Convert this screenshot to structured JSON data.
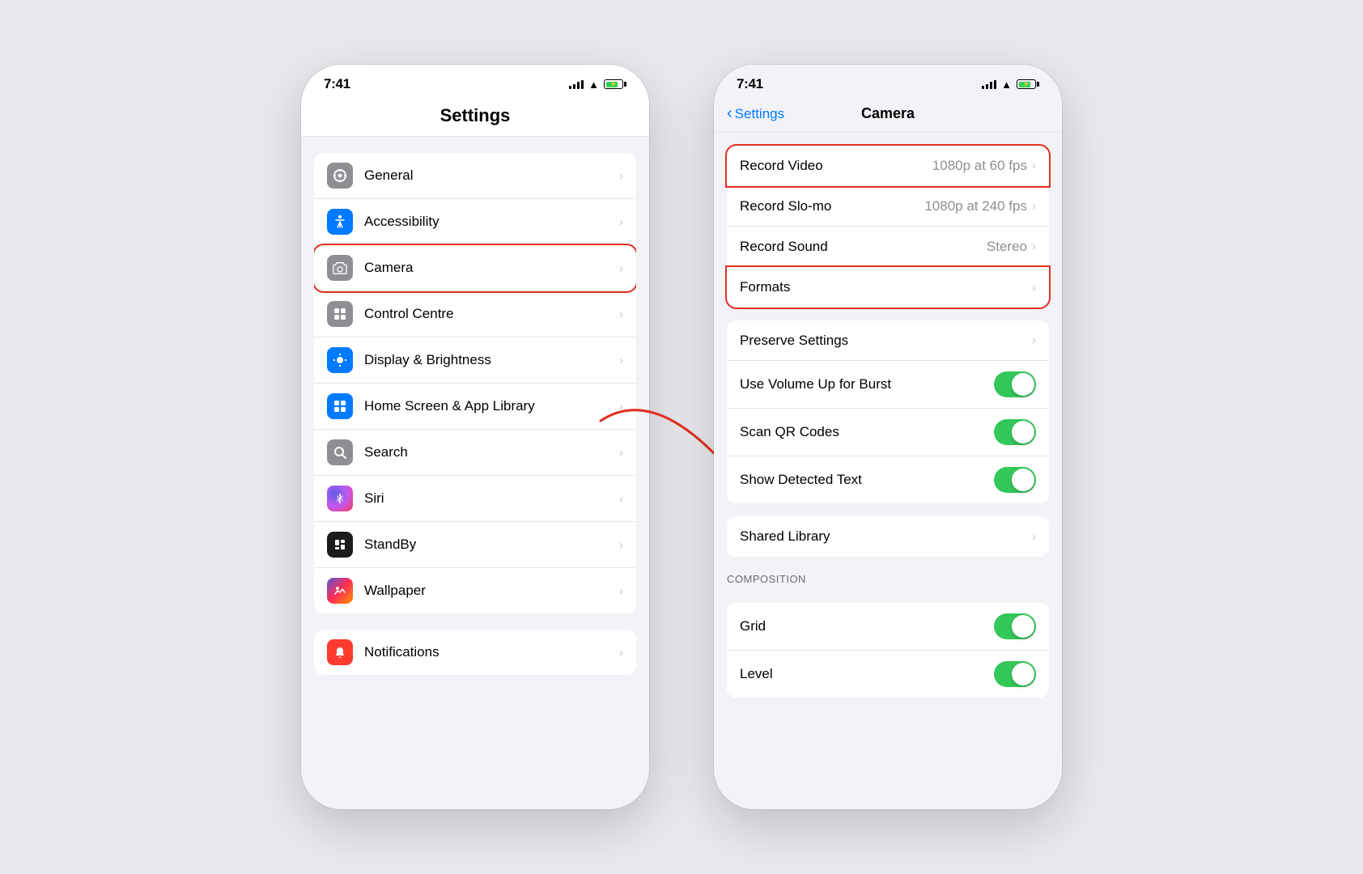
{
  "left_phone": {
    "status": {
      "time": "7:41",
      "battery_pct": 80
    },
    "header": {
      "title": "Settings"
    },
    "settings_items": [
      {
        "id": "general",
        "label": "General",
        "icon_type": "gray",
        "icon_symbol": "⚙️",
        "highlighted": false
      },
      {
        "id": "accessibility",
        "label": "Accessibility",
        "icon_type": "blue",
        "icon_symbol": "♿",
        "highlighted": false
      },
      {
        "id": "camera",
        "label": "Camera",
        "icon_type": "gray",
        "icon_symbol": "📷",
        "highlighted": true
      },
      {
        "id": "control-centre",
        "label": "Control Centre",
        "icon_type": "gray",
        "icon_symbol": "⊞",
        "highlighted": false
      },
      {
        "id": "display",
        "label": "Display & Brightness",
        "icon_type": "blue",
        "icon_symbol": "☀️",
        "highlighted": false
      },
      {
        "id": "home-screen",
        "label": "Home Screen & App Library",
        "icon_type": "blue",
        "icon_symbol": "📱",
        "highlighted": false
      },
      {
        "id": "search",
        "label": "Search",
        "icon_type": "gray",
        "icon_symbol": "🔍",
        "highlighted": false
      },
      {
        "id": "siri",
        "label": "Siri",
        "icon_type": "siri",
        "icon_symbol": "",
        "highlighted": false
      },
      {
        "id": "standby",
        "label": "StandBy",
        "icon_type": "black",
        "icon_symbol": "⏱",
        "highlighted": false
      },
      {
        "id": "wallpaper",
        "label": "Wallpaper",
        "icon_type": "wallpaper",
        "icon_symbol": "🌀",
        "highlighted": false
      }
    ],
    "bottom_items": [
      {
        "id": "notifications",
        "label": "Notifications",
        "icon_type": "red",
        "icon_symbol": "🔔",
        "highlighted": false
      }
    ]
  },
  "right_phone": {
    "status": {
      "time": "7:41",
      "battery_pct": 80
    },
    "nav": {
      "back_label": "Settings",
      "title": "Camera"
    },
    "camera_sections": [
      {
        "id": "recording",
        "rows": [
          {
            "id": "record-video",
            "label": "Record Video",
            "value": "1080p at 60 fps",
            "type": "nav",
            "highlighted": true
          },
          {
            "id": "record-slomo",
            "label": "Record Slo-mo",
            "value": "1080p at 240 fps",
            "type": "nav"
          },
          {
            "id": "record-sound",
            "label": "Record Sound",
            "value": "Stereo",
            "type": "nav"
          },
          {
            "id": "formats",
            "label": "Formats",
            "value": "",
            "type": "nav",
            "highlighted": true
          }
        ]
      },
      {
        "id": "camera-settings",
        "rows": [
          {
            "id": "preserve-settings",
            "label": "Preserve Settings",
            "value": "",
            "type": "nav"
          },
          {
            "id": "volume-burst",
            "label": "Use Volume Up for Burst",
            "value": "",
            "type": "toggle",
            "toggle_on": true
          },
          {
            "id": "scan-qr",
            "label": "Scan QR Codes",
            "value": "",
            "type": "toggle",
            "toggle_on": true
          },
          {
            "id": "detected-text",
            "label": "Show Detected Text",
            "value": "",
            "type": "toggle",
            "toggle_on": true
          }
        ]
      },
      {
        "id": "shared",
        "rows": [
          {
            "id": "shared-library",
            "label": "Shared Library",
            "value": "",
            "type": "nav"
          }
        ]
      }
    ],
    "composition_section": {
      "header": "COMPOSITION",
      "rows": [
        {
          "id": "grid",
          "label": "Grid",
          "type": "toggle",
          "toggle_on": true
        },
        {
          "id": "level",
          "label": "Level",
          "type": "toggle",
          "toggle_on": true
        }
      ]
    }
  },
  "arrow": {
    "color": "#e03020"
  }
}
